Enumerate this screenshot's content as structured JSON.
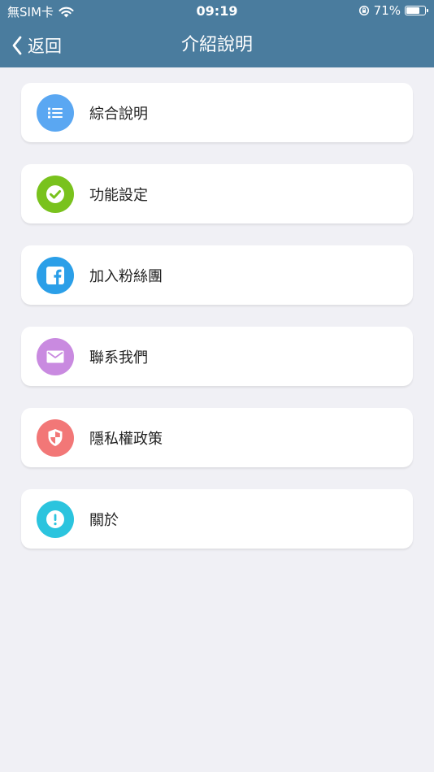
{
  "status_bar": {
    "carrier": "無SIM卡",
    "time": "09:19",
    "battery": "71%",
    "battery_level": 0.71
  },
  "nav": {
    "back_label": "返回",
    "title": "介紹說明"
  },
  "items": [
    {
      "label": "綜合說明",
      "icon": "list-icon",
      "color": "#5aa7f2"
    },
    {
      "label": "功能設定",
      "icon": "checkmark-icon",
      "color": "#79c21d"
    },
    {
      "label": "加入粉絲團",
      "icon": "facebook-icon",
      "color": "#2b9fe8"
    },
    {
      "label": "聯系我們",
      "icon": "mail-icon",
      "color": "#c98ae0"
    },
    {
      "label": "隱私權政策",
      "icon": "shield-icon",
      "color": "#f27777"
    },
    {
      "label": "關於",
      "icon": "info-icon",
      "color": "#2bc4de"
    }
  ],
  "colors": {
    "header": "#4a7c9e",
    "background": "#f0f0f5"
  }
}
